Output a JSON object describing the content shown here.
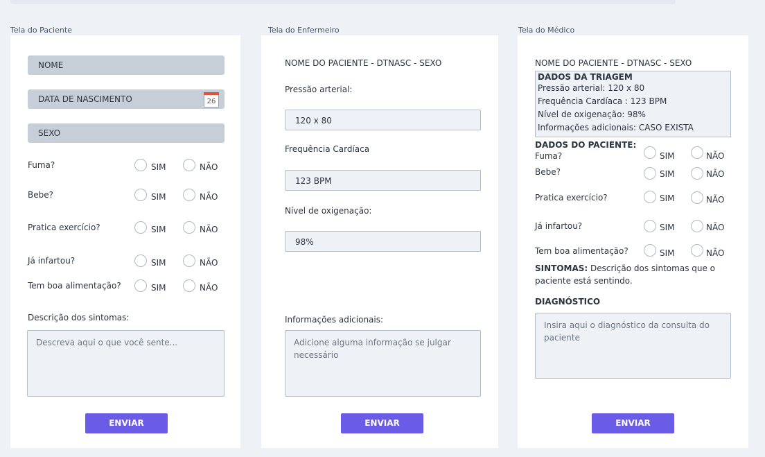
{
  "patient_screen": {
    "title": "Tela do Paciente",
    "name_field": "NOME",
    "birth_field": "DATA DE NASCIMENTO",
    "calendar_day": "26",
    "sex_field": "SEXO",
    "questions": [
      {
        "label": "Fuma?",
        "yes": "SIM",
        "no": "NÃO"
      },
      {
        "label": "Bebe?",
        "yes": "SIM",
        "no": "NÃO"
      },
      {
        "label": "Pratica exercício?",
        "yes": "SIM",
        "no": "NÃO"
      },
      {
        "label": "Já infartou?",
        "yes": "SIM",
        "no": "NÃO"
      },
      {
        "label": "Tem boa alimentação?",
        "yes": "SIM",
        "no": "NÃO"
      }
    ],
    "symptoms_label": "Descrição dos sintomas:",
    "symptoms_placeholder": "Descreva aqui o que você sente...",
    "submit": "ENVIAR"
  },
  "nurse_screen": {
    "title": "Tela do Enfermeiro",
    "patient_header": "NOME DO PACIENTE   - DTNASC  - SEXO",
    "bp_label": "Pressão arterial:",
    "bp_value": "120 x 80",
    "hr_label": "Frequência Cardíaca",
    "hr_value": "123 BPM",
    "ox_label": "Nível de oxigenação:",
    "ox_value": "98%",
    "info_label": "Informações adicionais:",
    "info_placeholder": "Adicione alguma informação se julgar necessário",
    "submit": "ENVIAR"
  },
  "doctor_screen": {
    "title": "Tela do Médico",
    "patient_header": "NOME DO PACIENTE   - DTNASC  - SEXO",
    "triage": {
      "heading": "DADOS DA TRIAGEM",
      "lines": [
        "Pressão arterial: 120 x 80",
        "Frequência Cardíaca : 123 BPM",
        "Nível de oxigenação: 98%",
        "Informações adicionais: CASO EXISTA"
      ]
    },
    "patient_data_heading": "DADOS DO PACIENTE:",
    "questions": [
      {
        "label": "Fuma?",
        "yes": "SIM",
        "no": "NÃO"
      },
      {
        "label": "Bebe?",
        "yes": "SIM",
        "no": "NÃO"
      },
      {
        "label": "Pratica exercício?",
        "yes": "SIM",
        "no": "NÃO"
      },
      {
        "label": "Já infartou?",
        "yes": "SIM",
        "no": "NÃO"
      },
      {
        "label": "Tem boa alimentação?",
        "yes": "SIM",
        "no": "NÃO"
      }
    ],
    "symptoms_heading": "SINTOMAS:",
    "symptoms_text": " Descrição dos sintomas que o paciente está sentindo.",
    "diagnosis_heading": "DIAGNÓSTICO",
    "diagnosis_placeholder": "Insira aqui o diagnóstico da consulta do paciente",
    "submit": "ENVIAR"
  },
  "colors": {
    "accent": "#6b5ce7",
    "field_fill": "#c6cfd8",
    "background": "#eef1f6"
  }
}
